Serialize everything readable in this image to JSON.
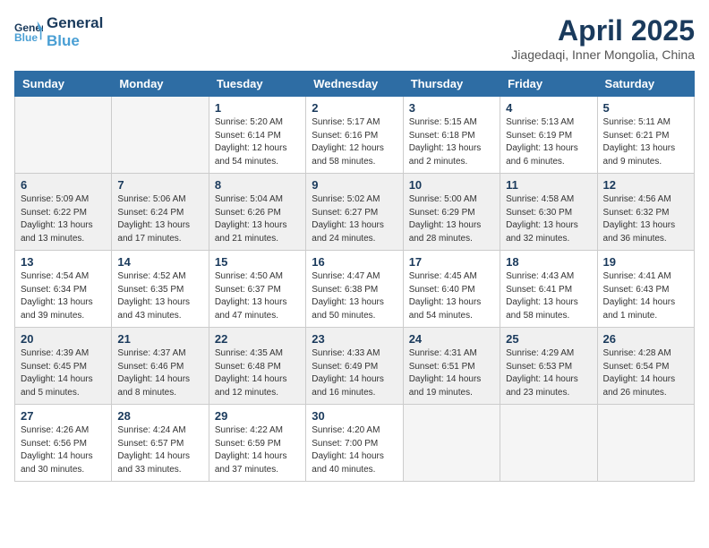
{
  "header": {
    "logo_line1": "General",
    "logo_line2": "Blue",
    "month": "April 2025",
    "location": "Jiagedaqi, Inner Mongolia, China"
  },
  "weekdays": [
    "Sunday",
    "Monday",
    "Tuesday",
    "Wednesday",
    "Thursday",
    "Friday",
    "Saturday"
  ],
  "weeks": [
    [
      {
        "day": "",
        "info": ""
      },
      {
        "day": "",
        "info": ""
      },
      {
        "day": "1",
        "info": "Sunrise: 5:20 AM\nSunset: 6:14 PM\nDaylight: 12 hours\nand 54 minutes."
      },
      {
        "day": "2",
        "info": "Sunrise: 5:17 AM\nSunset: 6:16 PM\nDaylight: 12 hours\nand 58 minutes."
      },
      {
        "day": "3",
        "info": "Sunrise: 5:15 AM\nSunset: 6:18 PM\nDaylight: 13 hours\nand 2 minutes."
      },
      {
        "day": "4",
        "info": "Sunrise: 5:13 AM\nSunset: 6:19 PM\nDaylight: 13 hours\nand 6 minutes."
      },
      {
        "day": "5",
        "info": "Sunrise: 5:11 AM\nSunset: 6:21 PM\nDaylight: 13 hours\nand 9 minutes."
      }
    ],
    [
      {
        "day": "6",
        "info": "Sunrise: 5:09 AM\nSunset: 6:22 PM\nDaylight: 13 hours\nand 13 minutes."
      },
      {
        "day": "7",
        "info": "Sunrise: 5:06 AM\nSunset: 6:24 PM\nDaylight: 13 hours\nand 17 minutes."
      },
      {
        "day": "8",
        "info": "Sunrise: 5:04 AM\nSunset: 6:26 PM\nDaylight: 13 hours\nand 21 minutes."
      },
      {
        "day": "9",
        "info": "Sunrise: 5:02 AM\nSunset: 6:27 PM\nDaylight: 13 hours\nand 24 minutes."
      },
      {
        "day": "10",
        "info": "Sunrise: 5:00 AM\nSunset: 6:29 PM\nDaylight: 13 hours\nand 28 minutes."
      },
      {
        "day": "11",
        "info": "Sunrise: 4:58 AM\nSunset: 6:30 PM\nDaylight: 13 hours\nand 32 minutes."
      },
      {
        "day": "12",
        "info": "Sunrise: 4:56 AM\nSunset: 6:32 PM\nDaylight: 13 hours\nand 36 minutes."
      }
    ],
    [
      {
        "day": "13",
        "info": "Sunrise: 4:54 AM\nSunset: 6:34 PM\nDaylight: 13 hours\nand 39 minutes."
      },
      {
        "day": "14",
        "info": "Sunrise: 4:52 AM\nSunset: 6:35 PM\nDaylight: 13 hours\nand 43 minutes."
      },
      {
        "day": "15",
        "info": "Sunrise: 4:50 AM\nSunset: 6:37 PM\nDaylight: 13 hours\nand 47 minutes."
      },
      {
        "day": "16",
        "info": "Sunrise: 4:47 AM\nSunset: 6:38 PM\nDaylight: 13 hours\nand 50 minutes."
      },
      {
        "day": "17",
        "info": "Sunrise: 4:45 AM\nSunset: 6:40 PM\nDaylight: 13 hours\nand 54 minutes."
      },
      {
        "day": "18",
        "info": "Sunrise: 4:43 AM\nSunset: 6:41 PM\nDaylight: 13 hours\nand 58 minutes."
      },
      {
        "day": "19",
        "info": "Sunrise: 4:41 AM\nSunset: 6:43 PM\nDaylight: 14 hours\nand 1 minute."
      }
    ],
    [
      {
        "day": "20",
        "info": "Sunrise: 4:39 AM\nSunset: 6:45 PM\nDaylight: 14 hours\nand 5 minutes."
      },
      {
        "day": "21",
        "info": "Sunrise: 4:37 AM\nSunset: 6:46 PM\nDaylight: 14 hours\nand 8 minutes."
      },
      {
        "day": "22",
        "info": "Sunrise: 4:35 AM\nSunset: 6:48 PM\nDaylight: 14 hours\nand 12 minutes."
      },
      {
        "day": "23",
        "info": "Sunrise: 4:33 AM\nSunset: 6:49 PM\nDaylight: 14 hours\nand 16 minutes."
      },
      {
        "day": "24",
        "info": "Sunrise: 4:31 AM\nSunset: 6:51 PM\nDaylight: 14 hours\nand 19 minutes."
      },
      {
        "day": "25",
        "info": "Sunrise: 4:29 AM\nSunset: 6:53 PM\nDaylight: 14 hours\nand 23 minutes."
      },
      {
        "day": "26",
        "info": "Sunrise: 4:28 AM\nSunset: 6:54 PM\nDaylight: 14 hours\nand 26 minutes."
      }
    ],
    [
      {
        "day": "27",
        "info": "Sunrise: 4:26 AM\nSunset: 6:56 PM\nDaylight: 14 hours\nand 30 minutes."
      },
      {
        "day": "28",
        "info": "Sunrise: 4:24 AM\nSunset: 6:57 PM\nDaylight: 14 hours\nand 33 minutes."
      },
      {
        "day": "29",
        "info": "Sunrise: 4:22 AM\nSunset: 6:59 PM\nDaylight: 14 hours\nand 37 minutes."
      },
      {
        "day": "30",
        "info": "Sunrise: 4:20 AM\nSunset: 7:00 PM\nDaylight: 14 hours\nand 40 minutes."
      },
      {
        "day": "",
        "info": ""
      },
      {
        "day": "",
        "info": ""
      },
      {
        "day": "",
        "info": ""
      }
    ]
  ]
}
